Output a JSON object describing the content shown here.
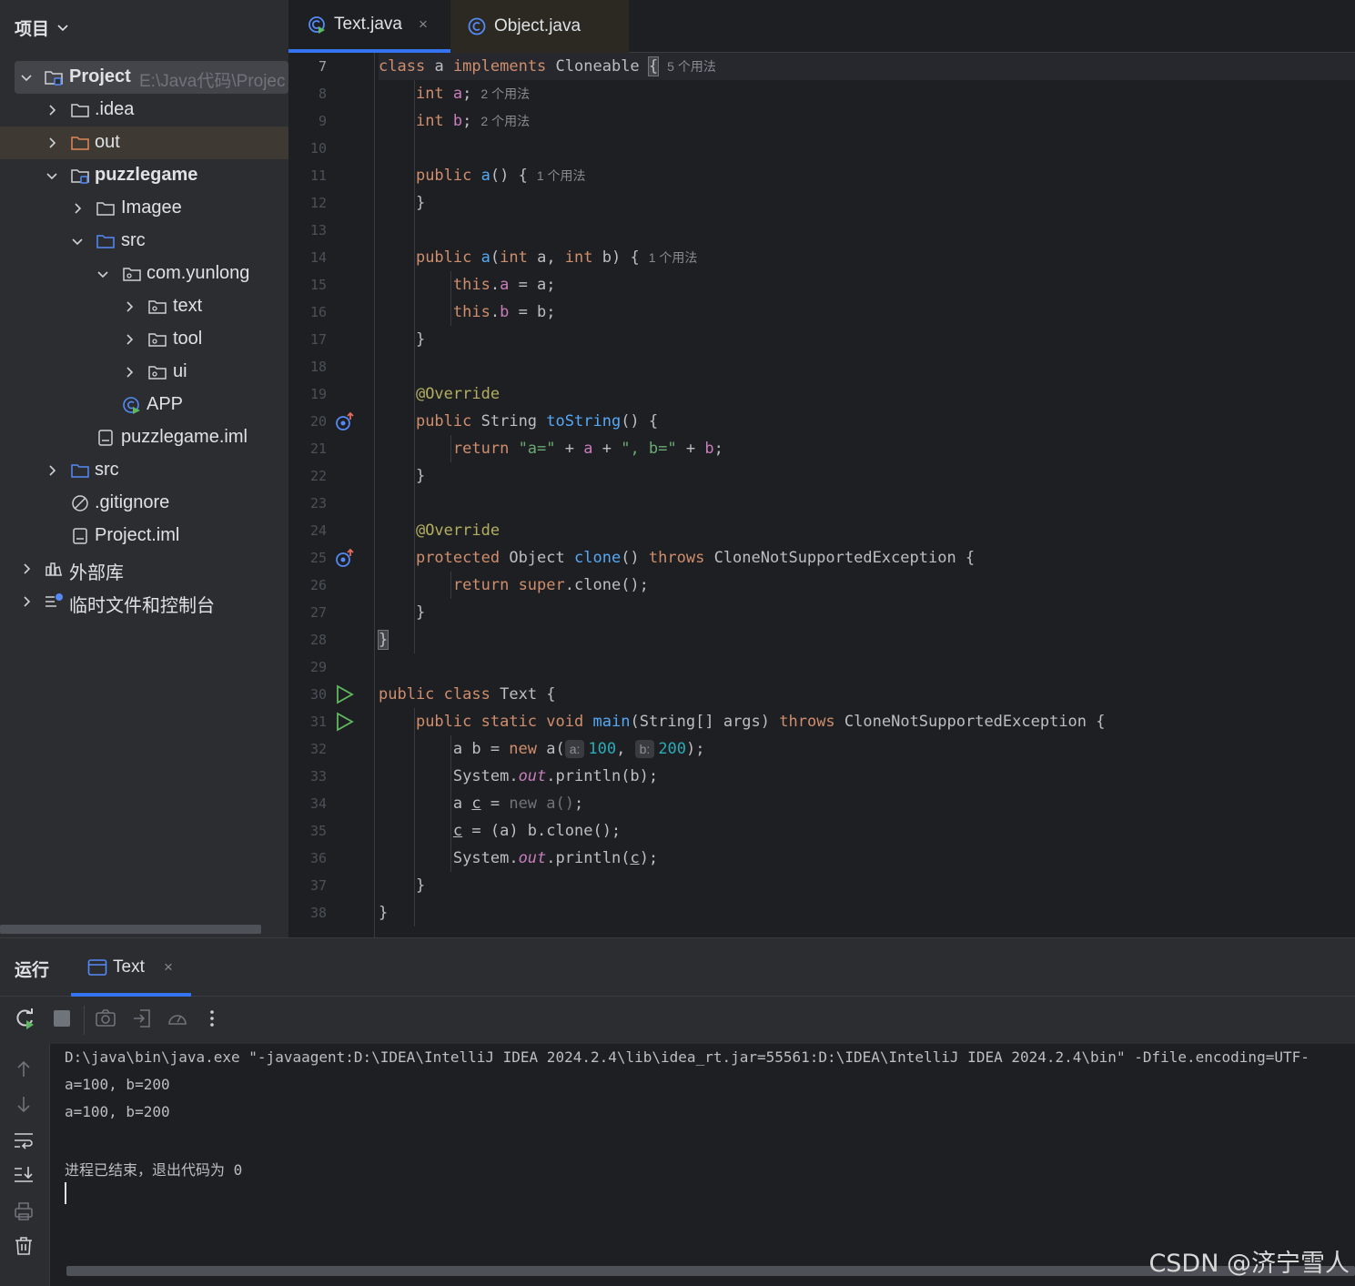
{
  "project_panel": {
    "title": "项目",
    "tree": [
      {
        "label": "Project",
        "path": "E:\\Java代码\\Projec",
        "icon": "module-folder-icon",
        "arrow": "expanded"
      },
      {
        "label": ".idea",
        "icon": "folder-icon",
        "arrow": "collapsed"
      },
      {
        "label": "out",
        "icon": "folder-orange-icon",
        "arrow": "collapsed"
      },
      {
        "label": "puzzlegame",
        "icon": "module-folder-icon",
        "arrow": "expanded"
      },
      {
        "label": "Imagee",
        "icon": "folder-icon",
        "arrow": "collapsed"
      },
      {
        "label": "src",
        "icon": "source-folder-icon",
        "arrow": "expanded"
      },
      {
        "label": "com.yunlong",
        "icon": "package-icon",
        "arrow": "expanded"
      },
      {
        "label": "text",
        "icon": "package-icon",
        "arrow": "collapsed"
      },
      {
        "label": "tool",
        "icon": "package-icon",
        "arrow": "collapsed"
      },
      {
        "label": "ui",
        "icon": "package-icon",
        "arrow": "collapsed"
      },
      {
        "label": "APP",
        "icon": "java-class-run-icon",
        "arrow": "none"
      },
      {
        "label": "puzzlegame.iml",
        "icon": "iml-file-icon",
        "arrow": "none"
      },
      {
        "label": "src",
        "icon": "source-folder-icon",
        "arrow": "collapsed"
      },
      {
        "label": ".gitignore",
        "icon": "ignore-file-icon",
        "arrow": "none"
      },
      {
        "label": "Project.iml",
        "icon": "iml-file-icon",
        "arrow": "none"
      },
      {
        "label": "外部库",
        "icon": "library-icon",
        "arrow": "collapsed"
      },
      {
        "label": "临时文件和控制台",
        "icon": "scratches-icon",
        "arrow": "collapsed"
      }
    ]
  },
  "editor": {
    "tabs": [
      {
        "label": "Text.java",
        "close": "×",
        "active": true,
        "icon": "java-class-run-icon"
      },
      {
        "label": "Object.java",
        "active": false,
        "icon": "class-icon"
      }
    ],
    "line_numbers": [
      "7",
      "8",
      "9",
      "10",
      "11",
      "12",
      "13",
      "14",
      "15",
      "16",
      "17",
      "18",
      "19",
      "20",
      "21",
      "22",
      "23",
      "24",
      "25",
      "26",
      "27",
      "28",
      "29",
      "30",
      "31",
      "32",
      "33",
      "34",
      "35",
      "36",
      "37",
      "38"
    ],
    "hints": {
      "l7": "5 个用法",
      "l8": "2 个用法",
      "l9": "2 个用法",
      "l11": "1 个用法",
      "l14": "1 个用法"
    },
    "inlay": {
      "a": "a:",
      "b": "b:"
    },
    "gutter_icons": {
      "l20": "override-method-icon",
      "l25": "override-method-icon",
      "l30": "run-icon",
      "l31": "run-icon"
    },
    "tokens": {
      "class": "class",
      "a": "a",
      "implements": "implements",
      "cloneable": "Cloneable",
      "int": "int",
      "public": "public",
      "this": "this",
      "override": "@Override",
      "string": "String",
      "tostring": "toString",
      "return": "return",
      "str_a_eq": "\"a=\"",
      "str_b_eq": "\", b=\"",
      "protected": "protected",
      "object": "Object",
      "clone": "clone",
      "throws": "throws",
      "cnse": "CloneNotSupportedException",
      "super": "super",
      "text": "Text",
      "static": "static",
      "void": "void",
      "main": "main",
      "new": "new",
      "n100": "100",
      "n200": "200",
      "system": "System",
      "out": "out",
      "println": "println"
    },
    "colors": {
      "keyword": "#cf8e6d",
      "function": "#56a8f5",
      "field": "#c77dbb",
      "string": "#6aab73",
      "number": "#2aacb8",
      "annotation": "#b3ae60",
      "text": "#bcbec4"
    }
  },
  "run_panel": {
    "title": "运行",
    "tab_label": "Text",
    "tab_close": "×",
    "tab_icon": "console-icon",
    "toolbar_icons": [
      "rerun-icon",
      "stop-icon",
      "camera-icon",
      "login-icon",
      "profiler-icon",
      "more-vertical-icon"
    ],
    "side_icons": [
      "arrow-up-icon",
      "arrow-down-icon",
      "soft-wrap-icon",
      "scroll-to-end-icon",
      "print-icon",
      "trash-icon"
    ],
    "console": [
      "D:\\java\\bin\\java.exe \"-javaagent:D:\\IDEA\\IntelliJ IDEA 2024.2.4\\lib\\idea_rt.jar=55561:D:\\IDEA\\IntelliJ IDEA 2024.2.4\\bin\" -Dfile.encoding=UTF-",
      "a=100, b=200",
      "a=100, b=200",
      "",
      "进程已结束，退出代码为 0"
    ]
  },
  "watermark": "CSDN @济宁雪人",
  "accent_color": "#3574f0"
}
